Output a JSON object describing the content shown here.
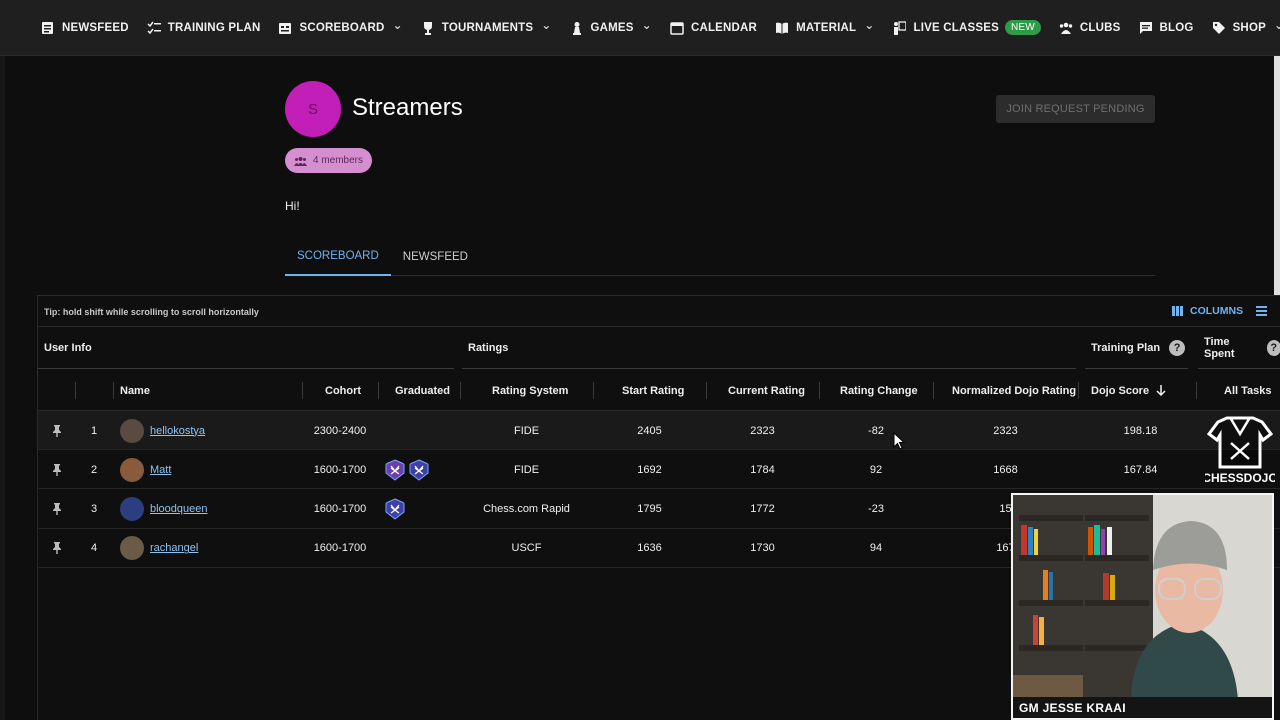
{
  "nav": {
    "items": [
      {
        "label": "NEWSFEED",
        "icon": "newspaper-icon",
        "dropdown": false
      },
      {
        "label": "TRAINING PLAN",
        "icon": "checklist-icon",
        "dropdown": false
      },
      {
        "label": "SCOREBOARD",
        "icon": "scoreboard-icon",
        "dropdown": true
      },
      {
        "label": "TOURNAMENTS",
        "icon": "trophy-icon",
        "dropdown": true
      },
      {
        "label": "GAMES",
        "icon": "pawn-icon",
        "dropdown": true
      },
      {
        "label": "CALENDAR",
        "icon": "calendar-icon",
        "dropdown": false
      },
      {
        "label": "MATERIAL",
        "icon": "book-icon",
        "dropdown": true
      },
      {
        "label": "LIVE CLASSES",
        "icon": "presenter-icon",
        "dropdown": false,
        "badge": "NEW"
      },
      {
        "label": "CLUBS",
        "icon": "group-icon",
        "dropdown": false
      },
      {
        "label": "BLOG",
        "icon": "chat-icon",
        "dropdown": false
      },
      {
        "label": "SHOP",
        "icon": "tag-icon",
        "dropdown": true
      }
    ]
  },
  "club": {
    "avatar_letter": "S",
    "name": "Streamers",
    "members": "4 members",
    "join_button": "JOIN REQUEST PENDING",
    "description": "Hi!"
  },
  "tabs": [
    {
      "label": "SCOREBOARD",
      "active": true
    },
    {
      "label": "NEWSFEED",
      "active": false
    }
  ],
  "grid": {
    "tip": "Tip: hold shift while scrolling to scroll horizontally",
    "columns_button": "COLUMNS",
    "groups": {
      "user_info": "User Info",
      "ratings": "Ratings",
      "training_plan": "Training Plan",
      "time_spent": "Time Spent"
    },
    "headers": {
      "name": "Name",
      "cohort": "Cohort",
      "graduated": "Graduated",
      "rating_system": "Rating System",
      "start_rating": "Start Rating",
      "current_rating": "Current Rating",
      "rating_change": "Rating Change",
      "normalized": "Normalized Dojo Rating",
      "dojo_score": "Dojo Score",
      "all_tasks": "All Tasks"
    },
    "rows": [
      {
        "rank": "1",
        "name": "hellokostya",
        "cohort": "2300-2400",
        "system": "FIDE",
        "start": "2405",
        "current": "2323",
        "change": "-82",
        "normalized": "2323",
        "dojo": "198.18",
        "badges": 0,
        "avatar_color": "#5a4a40"
      },
      {
        "rank": "2",
        "name": "Matt",
        "cohort": "1600-1700",
        "system": "FIDE",
        "start": "1692",
        "current": "1784",
        "change": "92",
        "normalized": "1668",
        "dojo": "167.84",
        "badges": 2,
        "avatar_color": "#8a5a3c"
      },
      {
        "rank": "3",
        "name": "bloodqueen",
        "cohort": "1600-1700",
        "system": "Chess.com Rapid",
        "start": "1795",
        "current": "1772",
        "change": "-23",
        "normalized": "15",
        "dojo": "",
        "badges": 1,
        "avatar_color": "#2c3e80"
      },
      {
        "rank": "4",
        "name": "rachangel",
        "cohort": "1600-1700",
        "system": "USCF",
        "start": "1636",
        "current": "1730",
        "change": "94",
        "normalized": "167",
        "dojo": "",
        "badges": 0,
        "avatar_color": "#6b5a48"
      }
    ]
  },
  "watermark": "CHESSDOJO",
  "webcam": {
    "label": "GM JESSE KRAAI"
  },
  "colors": {
    "accent": "#6fb3f3",
    "club": "#c21fb8",
    "new_badge": "#2e9b46",
    "graduated_badge": "#3f3fa8"
  }
}
